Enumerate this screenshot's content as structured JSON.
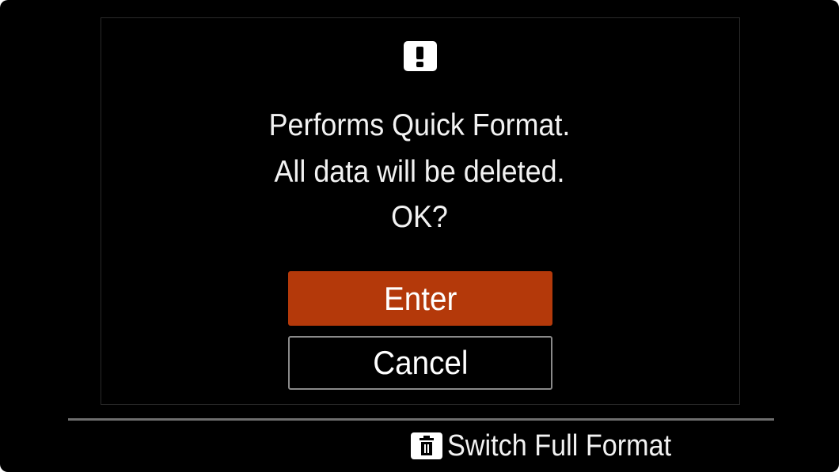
{
  "dialog": {
    "icon": "warning-exclamation-icon",
    "message_lines": [
      "Performs Quick Format.",
      "All data will be deleted.",
      "OK?"
    ],
    "enter_label": "Enter",
    "cancel_label": "Cancel"
  },
  "footer": {
    "icon": "trash-icon",
    "switch_label": "Switch Full Format"
  },
  "colors": {
    "background": "#000000",
    "accent_selected": "#b4390a",
    "text": "#ffffff"
  }
}
